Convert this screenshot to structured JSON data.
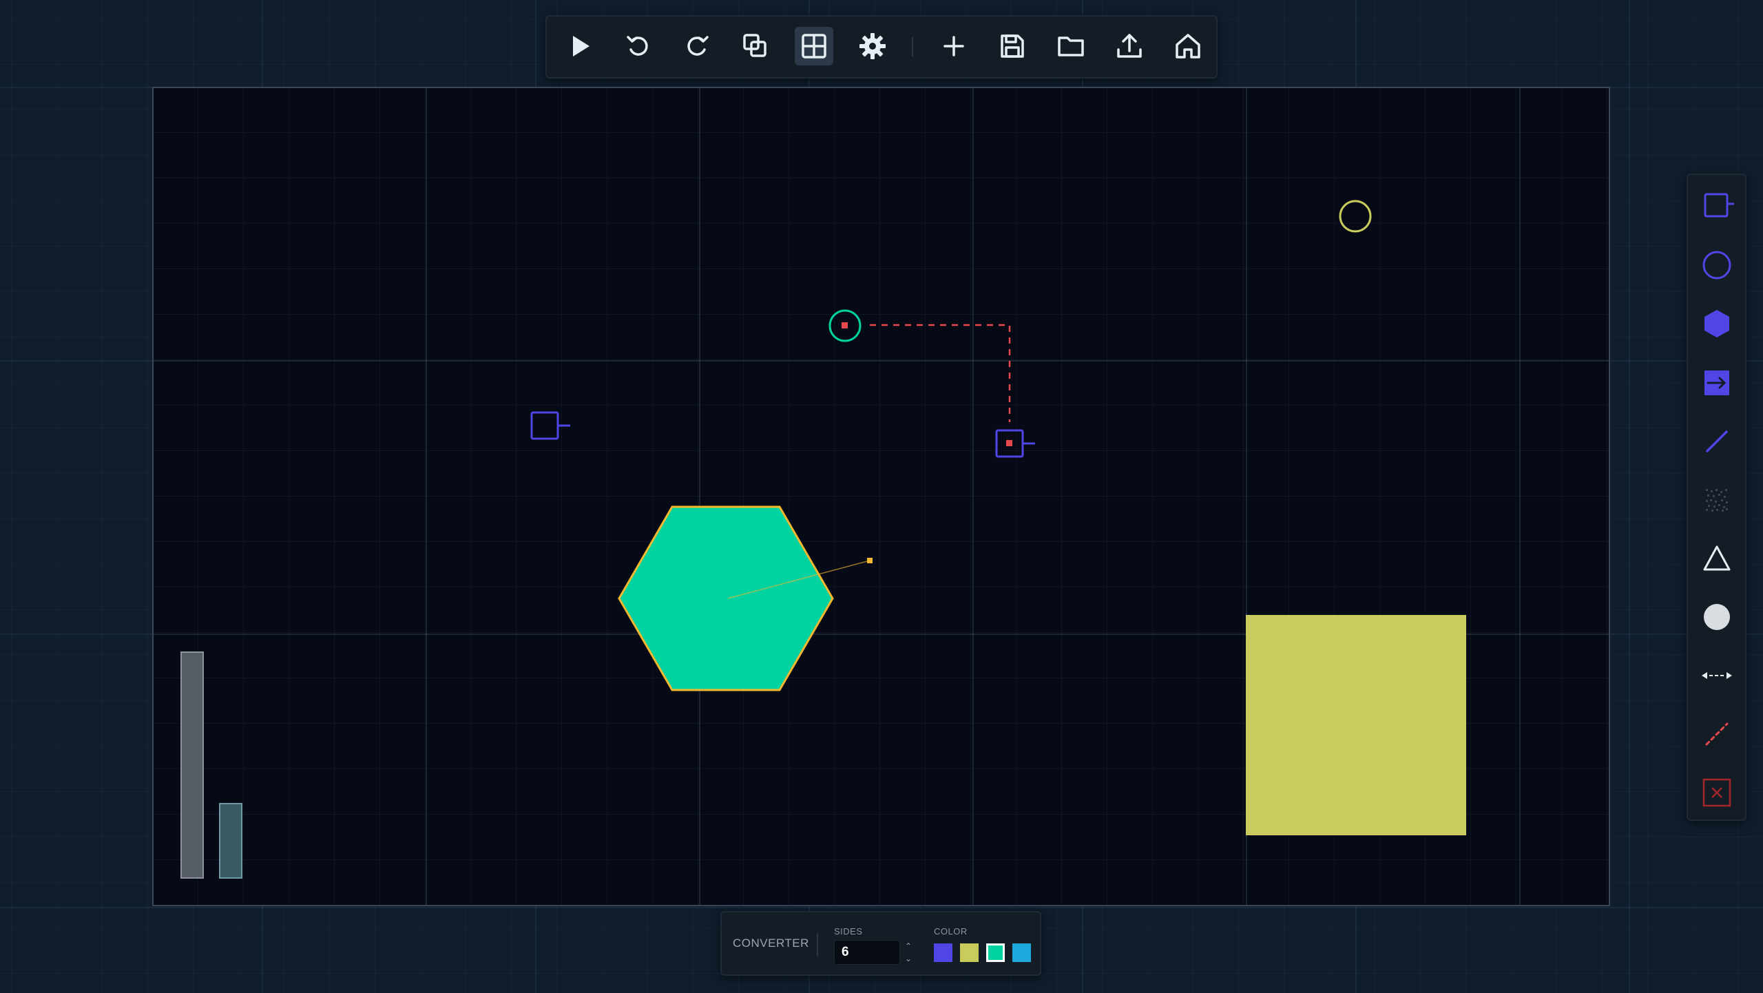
{
  "toolbar": {
    "buttons": [
      {
        "id": "play",
        "icon": "play-icon"
      },
      {
        "id": "undo",
        "icon": "undo-icon"
      },
      {
        "id": "redo",
        "icon": "redo-icon"
      },
      {
        "id": "duplicate",
        "icon": "duplicate-icon"
      },
      {
        "id": "grid",
        "icon": "grid-icon",
        "active": true
      },
      {
        "id": "settings",
        "icon": "gear-icon"
      },
      {
        "id": "add",
        "icon": "plus-icon"
      },
      {
        "id": "save",
        "icon": "save-icon"
      },
      {
        "id": "open",
        "icon": "folder-icon"
      },
      {
        "id": "export",
        "icon": "upload-icon"
      },
      {
        "id": "home",
        "icon": "home-icon"
      }
    ]
  },
  "palette": {
    "tools": [
      {
        "id": "source",
        "icon": "source-box-icon"
      },
      {
        "id": "circle",
        "icon": "circle-outline-icon"
      },
      {
        "id": "converter",
        "icon": "hexagon-icon"
      },
      {
        "id": "output",
        "icon": "arrow-box-icon"
      },
      {
        "id": "line",
        "icon": "line-icon"
      },
      {
        "id": "noise",
        "icon": "noise-icon"
      },
      {
        "id": "triangle",
        "icon": "triangle-icon"
      },
      {
        "id": "ball",
        "icon": "filled-circle-icon"
      },
      {
        "id": "spring",
        "icon": "dashed-arrows-icon"
      },
      {
        "id": "link",
        "icon": "dashed-line-icon"
      },
      {
        "id": "delete",
        "icon": "delete-box-icon"
      }
    ]
  },
  "panel": {
    "type_label": "CONVERTER",
    "sides_label": "SIDES",
    "sides_value": "6",
    "color_label": "COLOR",
    "colors": [
      "#4f46e5",
      "#c9cb5c",
      "#00d2a0",
      "#1fa8dc"
    ],
    "selected_color": "#00d2a0"
  },
  "scene": {
    "accent_colors": {
      "emitter": "#00d2a0",
      "link": "#e5484d",
      "box": "#4f46e5",
      "selection": "#f5b82e",
      "target": "#c9cb5c"
    }
  }
}
